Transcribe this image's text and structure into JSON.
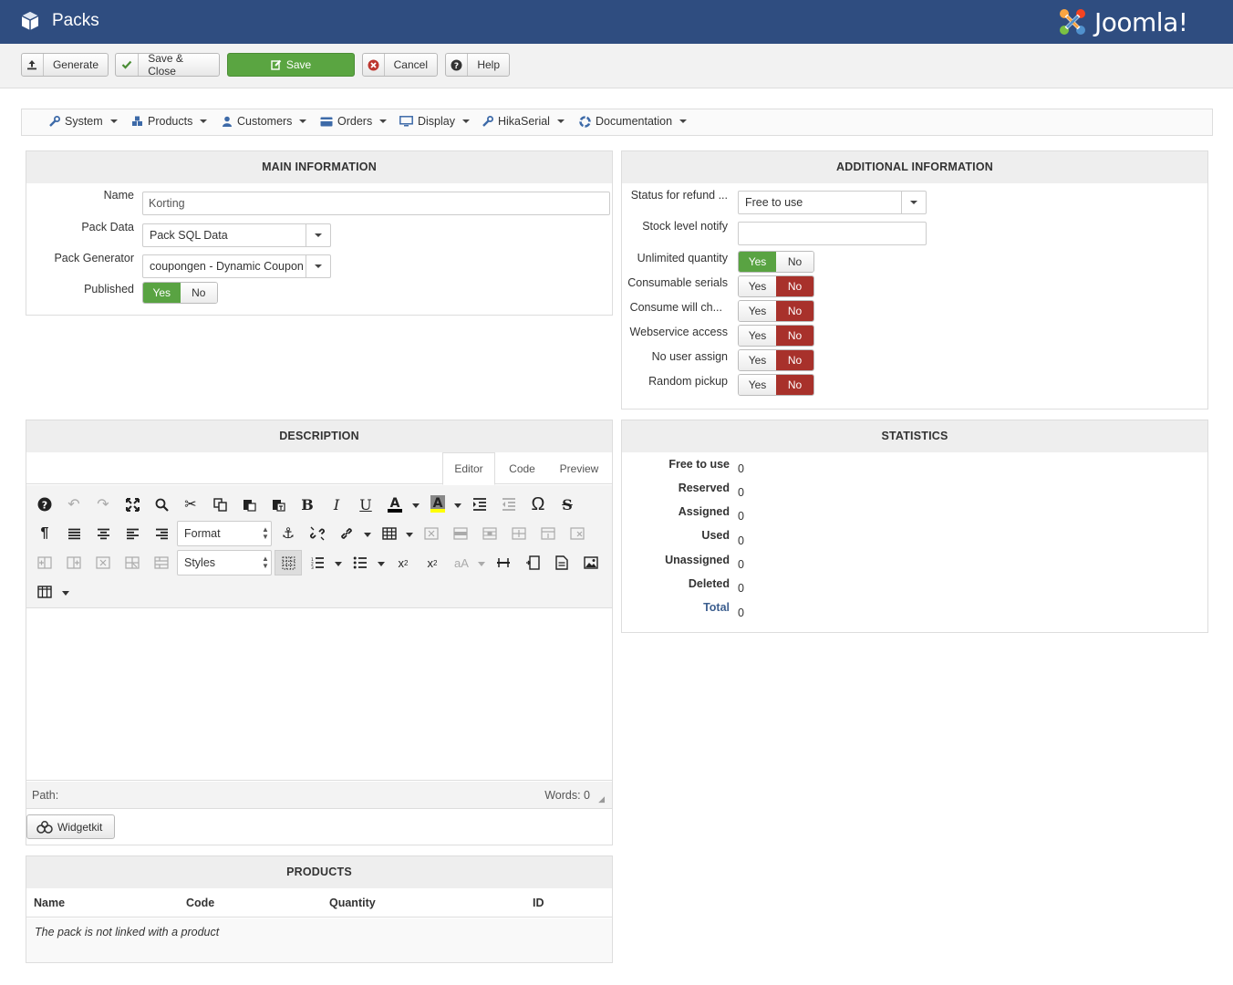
{
  "header": {
    "title": "Packs",
    "logo_text": "Joomla!"
  },
  "toolbar": {
    "generate": "Generate",
    "save_close": "Save & Close",
    "save": "Save",
    "cancel": "Cancel",
    "help": "Help"
  },
  "nav": {
    "items": [
      "System",
      "Products",
      "Customers",
      "Orders",
      "Display",
      "HikaSerial",
      "Documentation"
    ]
  },
  "main_info": {
    "heading": "MAIN INFORMATION",
    "name_label": "Name",
    "name_value": "Korting",
    "pack_data_label": "Pack Data",
    "pack_data_value": "Pack SQL Data",
    "pack_generator_label": "Pack Generator",
    "pack_generator_value": "coupongen - Dynamic Coupon",
    "published_label": "Published",
    "published_value": "Yes"
  },
  "additional": {
    "heading": "ADDITIONAL INFORMATION",
    "status_refund_label": "Status for refund ...",
    "status_refund_value": "Free to use",
    "stock_notify_label": "Stock level notify",
    "stock_notify_value": "",
    "toggles": [
      {
        "label": "Unlimited quantity",
        "value": "Yes"
      },
      {
        "label": "Consumable serials",
        "value": "No"
      },
      {
        "label": "Consume will ch...",
        "value": "No"
      },
      {
        "label": "Webservice access",
        "value": "No"
      },
      {
        "label": "No user assign",
        "value": "No"
      },
      {
        "label": "Random pickup",
        "value": "No"
      }
    ],
    "yes": "Yes",
    "no": "No"
  },
  "description": {
    "heading": "DESCRIPTION",
    "tabs": [
      "Editor",
      "Code",
      "Preview"
    ],
    "active_tab": "Editor",
    "format_label": "Format",
    "styles_label": "Styles",
    "path_label": "Path:",
    "words_label": "Words: 0",
    "widgetkit_label": "Widgetkit"
  },
  "statistics": {
    "heading": "STATISTICS",
    "rows": [
      {
        "label": "Free to use",
        "value": "0"
      },
      {
        "label": "Reserved",
        "value": "0"
      },
      {
        "label": "Assigned",
        "value": "0"
      },
      {
        "label": "Used",
        "value": "0"
      },
      {
        "label": "Unassigned",
        "value": "0"
      },
      {
        "label": "Deleted",
        "value": "0"
      },
      {
        "label": "Total",
        "value": "0"
      }
    ]
  },
  "products": {
    "heading": "PRODUCTS",
    "columns": [
      "Name",
      "Code",
      "Quantity",
      "ID"
    ],
    "empty_message": "The pack is not linked with a product"
  },
  "colors": {
    "header_bg": "#2f4d80",
    "green": "#5aa541",
    "red": "#a8312b",
    "total_link": "#3d5f8f"
  }
}
